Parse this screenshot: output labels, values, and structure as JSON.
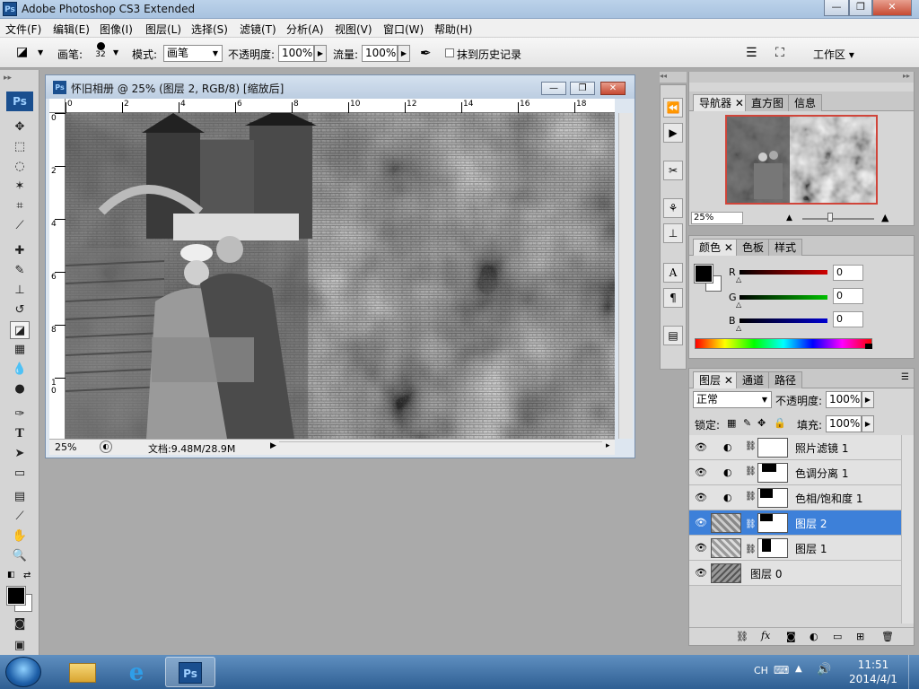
{
  "window": {
    "title": "Adobe Photoshop CS3 Extended",
    "app_icon": "Ps"
  },
  "menu": [
    "文件(F)",
    "编辑(E)",
    "图像(I)",
    "图层(L)",
    "选择(S)",
    "滤镜(T)",
    "分析(A)",
    "视图(V)",
    "窗口(W)",
    "帮助(H)"
  ],
  "options": {
    "brush_label": "画笔:",
    "brush_size": "32",
    "mode_label": "模式:",
    "mode_value": "画笔",
    "opacity_label": "不透明度:",
    "opacity_value": "100%",
    "flow_label": "流量:",
    "flow_value": "100%",
    "erase_history_label": "抹到历史记录",
    "workspace_label": "工作区 ▾"
  },
  "toolbox": {
    "logo": "Ps"
  },
  "document": {
    "title": "怀旧相册 @ 25% (图层 2, RGB/8) [缩放后]",
    "zoom": "25%",
    "doc_info": "文档:9.48M/28.9M",
    "ruler_h": [
      "0",
      "2",
      "4",
      "6",
      "8",
      "10",
      "12",
      "14",
      "16",
      "18"
    ],
    "ruler_v": [
      "0",
      "2",
      "4",
      "6",
      "8",
      "1\n0"
    ]
  },
  "navigator": {
    "tabs": [
      "导航器",
      "直方图",
      "信息"
    ],
    "zoom": "25%"
  },
  "color_panel": {
    "tabs": [
      "颜色",
      "色板",
      "样式"
    ],
    "channels": [
      {
        "label": "R",
        "value": "0",
        "color": "#c00000"
      },
      {
        "label": "G",
        "value": "0",
        "color": "#00b000"
      },
      {
        "label": "B",
        "value": "0",
        "color": "#0000c0"
      }
    ]
  },
  "layers_panel": {
    "tabs": [
      "图层",
      "通道",
      "路径"
    ],
    "blend_mode": "正常",
    "opacity_label": "不透明度:",
    "opacity_value": "100%",
    "lock_label": "锁定:",
    "fill_label": "填充:",
    "fill_value": "100%",
    "layers": [
      {
        "name": "照片滤镜 1",
        "type": "adjustment",
        "selected": false
      },
      {
        "name": "色调分离 1",
        "type": "adjustment",
        "selected": false
      },
      {
        "name": "色相/饱和度 1",
        "type": "adjustment",
        "selected": false
      },
      {
        "name": "图层 2",
        "type": "pixel-mask",
        "selected": true
      },
      {
        "name": "图层 1",
        "type": "pixel-mask",
        "selected": false
      },
      {
        "name": "图层 0",
        "type": "pixel",
        "selected": false
      }
    ]
  },
  "taskbar": {
    "lang": "CH",
    "time": "11:51",
    "date": "2014/4/1",
    "ps_label": "Ps"
  }
}
